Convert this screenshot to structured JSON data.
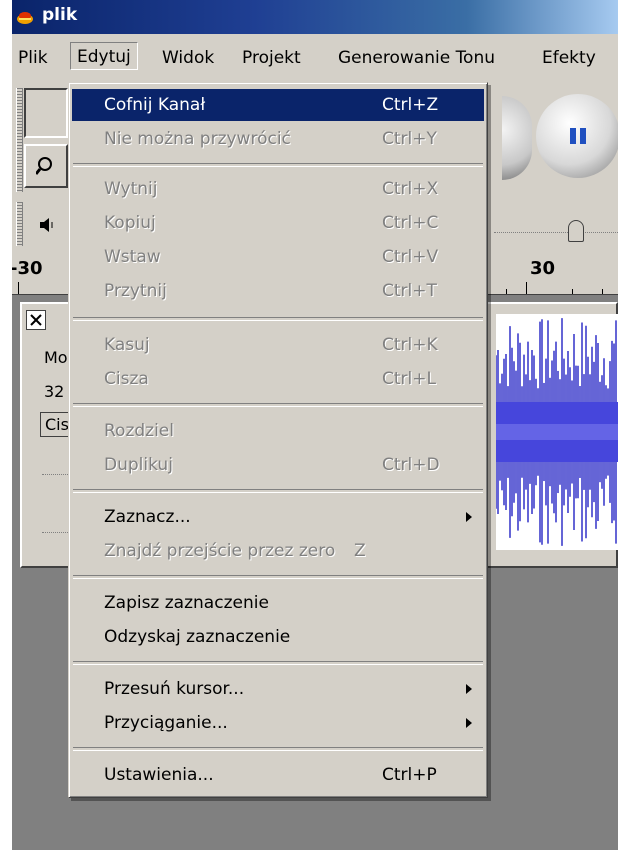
{
  "window": {
    "title": "plik"
  },
  "menubar": [
    "Plik",
    "Edytuj",
    "Widok",
    "Projekt",
    "Generowanie Tonu",
    "Efekty"
  ],
  "ruler": {
    "left_label": "-30",
    "right_label": "30"
  },
  "track": {
    "rows": [
      "Mo",
      "32",
      "Cis"
    ]
  },
  "menu": {
    "items": [
      {
        "label": "Cofnij Kanał",
        "shortcut": "Ctrl+Z",
        "state": "highlighted"
      },
      {
        "label": "Nie można przywrócić",
        "shortcut": "Ctrl+Y",
        "state": "disabled"
      },
      {
        "label": "Wytnij",
        "shortcut": "Ctrl+X",
        "state": "disabled"
      },
      {
        "label": "Kopiuj",
        "shortcut": "Ctrl+C",
        "state": "disabled"
      },
      {
        "label": "Wstaw",
        "shortcut": "Ctrl+V",
        "state": "disabled"
      },
      {
        "label": "Przytnij",
        "shortcut": "Ctrl+T",
        "state": "disabled"
      },
      {
        "label": "Kasuj",
        "shortcut": "Ctrl+K",
        "state": "disabled"
      },
      {
        "label": "Cisza",
        "shortcut": "Ctrl+L",
        "state": "disabled"
      },
      {
        "label": "Rozdziel",
        "shortcut": "",
        "state": "disabled"
      },
      {
        "label": "Duplikuj",
        "shortcut": "Ctrl+D",
        "state": "disabled"
      },
      {
        "label": "Zaznacz...",
        "shortcut": "",
        "state": "enabled",
        "submenu": true
      },
      {
        "label": "Znajdź przejście przez zero",
        "shortcut": "Z",
        "state": "disabled"
      },
      {
        "label": "Zapisz zaznaczenie",
        "shortcut": "",
        "state": "enabled"
      },
      {
        "label": "Odzyskaj zaznaczenie",
        "shortcut": "",
        "state": "enabled"
      },
      {
        "label": "Przesuń kursor...",
        "shortcut": "",
        "state": "enabled",
        "submenu": true
      },
      {
        "label": "Przyciąganie...",
        "shortcut": "",
        "state": "enabled",
        "submenu": true
      },
      {
        "label": "Ustawienia...",
        "shortcut": "Ctrl+P",
        "state": "enabled"
      }
    ]
  },
  "colors": {
    "highlight": "#0a246a",
    "waveform": "#3232c8",
    "face": "#d4d0c8"
  }
}
